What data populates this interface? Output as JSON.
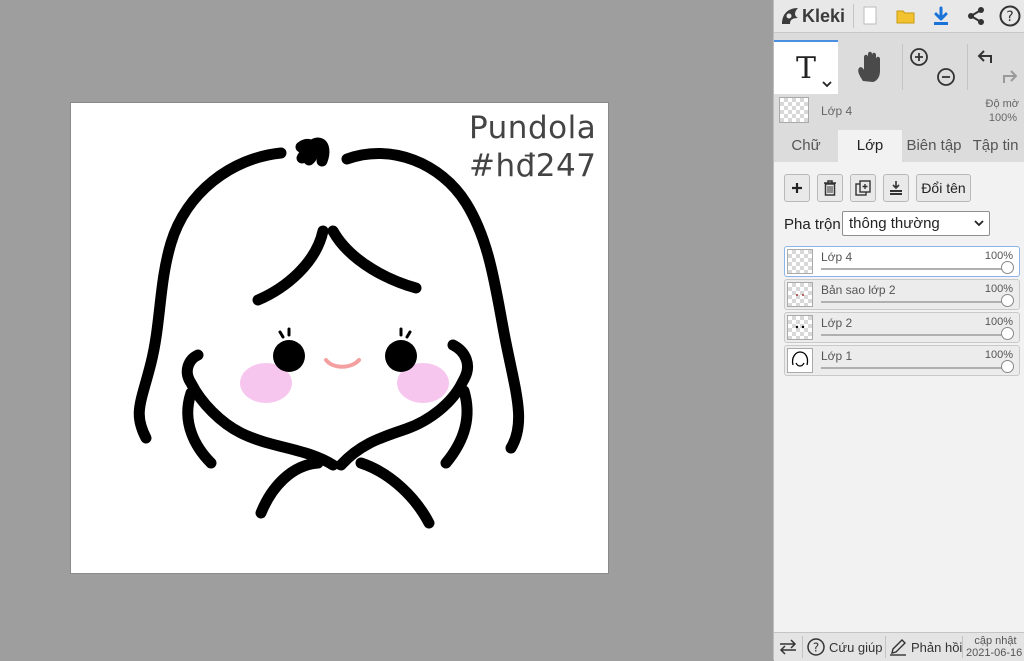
{
  "app": {
    "name": "Kleki"
  },
  "canvas": {
    "text_line1": "Pundola",
    "text_line2": "#hđ247",
    "background": "#ffffff",
    "blush_color": "#f7c6ee",
    "mouth_color": "#f4a0a0"
  },
  "toolbar": {
    "icons": [
      "new-file-icon",
      "open-folder-icon",
      "download-icon",
      "share-icon",
      "help-icon"
    ],
    "accent": "#1a73d9"
  },
  "tools": {
    "text_glyph": "T",
    "icons": [
      "text-tool-icon",
      "hand-tool-icon",
      "zoom-in-icon",
      "zoom-out-icon",
      "undo-icon",
      "redo-icon"
    ]
  },
  "active_layer": {
    "name": "Lớp 4",
    "opacity_label": "Độ mờ",
    "opacity_value": "100%"
  },
  "tabs": [
    {
      "label": "Chữ",
      "active": false
    },
    {
      "label": "Lớp",
      "active": true
    },
    {
      "label": "Biên tập",
      "active": false
    },
    {
      "label": "Tập tin",
      "active": false
    }
  ],
  "layer_panel": {
    "rename_label": "Đổi tên",
    "blend_label": "Pha trộn",
    "blend_value": "thông thường",
    "layers": [
      {
        "name": "Lớp 4",
        "opacity": "100%",
        "selected": true
      },
      {
        "name": "Bản sao lớp 2",
        "opacity": "100%",
        "selected": false
      },
      {
        "name": "Lớp 2",
        "opacity": "100%",
        "selected": false
      },
      {
        "name": "Lớp 1",
        "opacity": "100%",
        "selected": false
      }
    ]
  },
  "bottom": {
    "help_label": "Cứu giúp",
    "feedback_label": "Phản hồi",
    "update_label": "cập nhật",
    "update_date": "2021-06-16"
  }
}
